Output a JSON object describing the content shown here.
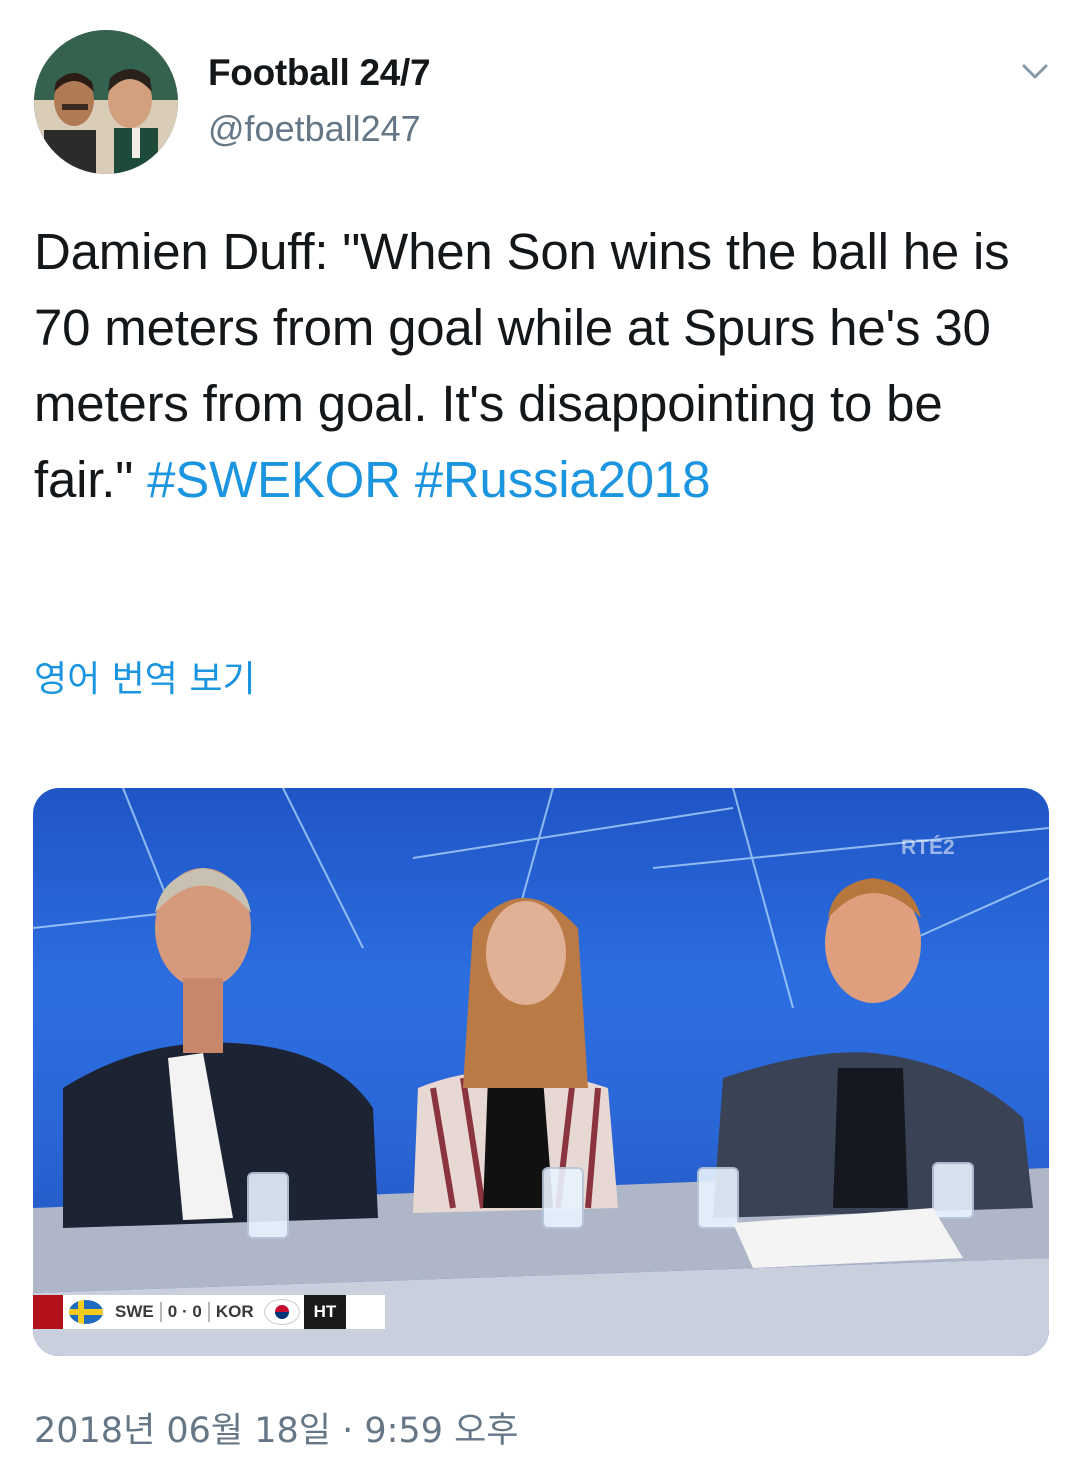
{
  "author": {
    "name": "Football 24/7",
    "handle": "@foetball247",
    "avatar_icon": "profile-photo"
  },
  "menu_icon": "chevron-down-icon",
  "tweet": {
    "text": "Damien Duff: \"When Son wins the ball he is 70 meters from goal while at Spurs he's 30 meters from goal. It's disappointing to be fair.\"",
    "hashtags": [
      "#SWEKOR",
      "#Russia2018"
    ]
  },
  "translate_link": "영어 번역 보기",
  "media": {
    "watermark": "RTÉ2",
    "scoreboard": {
      "home_team": "SWE",
      "home_score": "0",
      "separator": "·",
      "away_score": "0",
      "away_team": "KOR",
      "period": "HT"
    }
  },
  "timestamp": "2018년 06월 18일 · 9:59 오후",
  "colors": {
    "link": "#1b95e0",
    "secondary_text": "#657786",
    "primary_text": "#14171a"
  }
}
